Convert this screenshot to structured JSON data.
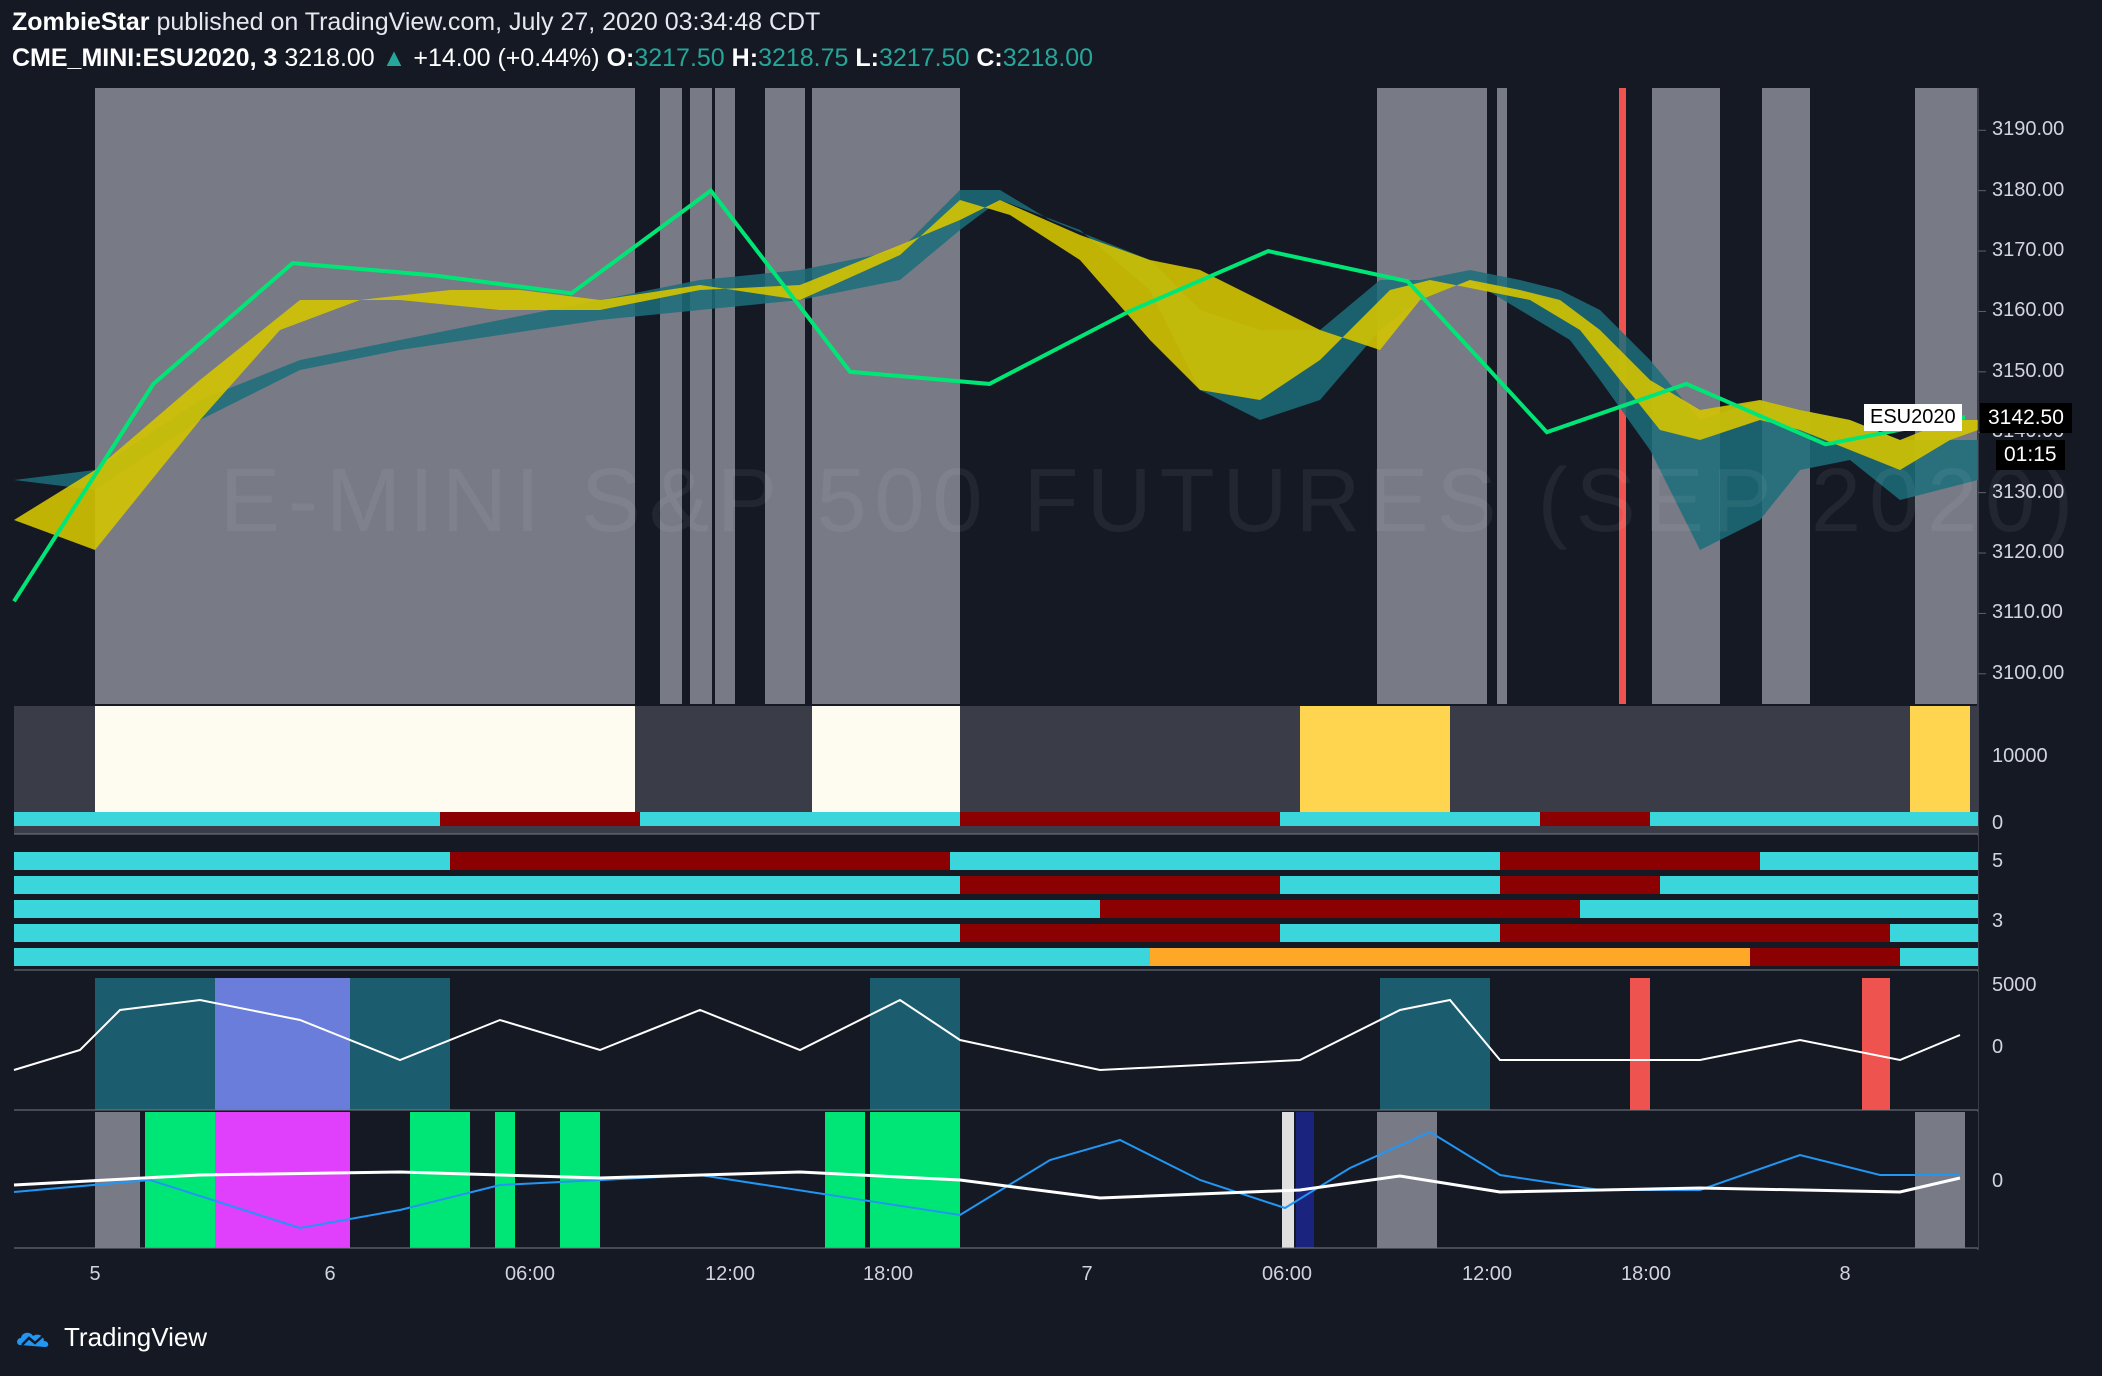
{
  "header": {
    "author": "ZombieStar",
    "published_text": "published on TradingView.com, July 27, 2020 03:34:48 CDT",
    "symbol": "CME_MINI:ESU2020, 3",
    "last": "3218.00",
    "change": "+14.00 (+0.44%)",
    "open_label": "O:",
    "open": "3217.50",
    "high_label": "H:",
    "high": "3218.75",
    "low_label": "L:",
    "low": "3217.50",
    "close_label": "C:",
    "close": "3218.00"
  },
  "watermark": "E-MINI S&P 500 FUTURES (SEP 2020)",
  "price_axis": [
    "3190.00",
    "3180.00",
    "3170.00",
    "3160.00",
    "3150.00",
    "3140.00",
    "3130.00",
    "3120.00",
    "3110.00",
    "3100.00"
  ],
  "price_label": {
    "symbol": "ESU2020",
    "price": "3142.50",
    "countdown": "01:15"
  },
  "volume_axis": [
    "10000",
    "0"
  ],
  "ribbon_axis": [
    "5",
    "3"
  ],
  "osc_axis": [
    "5000",
    "0"
  ],
  "bottom_axis": [
    "0"
  ],
  "time_axis": [
    "5",
    "6",
    "06:00",
    "12:00",
    "18:00",
    "7",
    "06:00",
    "12:00",
    "18:00",
    "8"
  ],
  "footer": {
    "brand": "TradingView"
  },
  "colors": {
    "bg": "#151924",
    "grey_session": "#787b86",
    "up": "#00e676",
    "down": "#f44336",
    "teal": "#26a69a",
    "cyan": "#3ad6dc",
    "darkred": "#8b0000",
    "yellow": "#e6d000",
    "magenta": "#e040fb"
  },
  "chart_data": {
    "type": "line",
    "title": "CME_MINI:ESU2020, 3",
    "ylabel": "",
    "ylim": [
      3095,
      3197
    ],
    "x": [
      "5",
      "6",
      "06:00",
      "12:00",
      "18:00",
      "7",
      "06:00",
      "12:00",
      "18:00",
      "8"
    ],
    "series": [
      {
        "values": [
          3112,
          3148,
          3168,
          3166,
          3163,
          3180,
          3150,
          3148,
          3160,
          3170,
          3165,
          3140,
          3148,
          3138,
          3142.5
        ]
      }
    ]
  }
}
